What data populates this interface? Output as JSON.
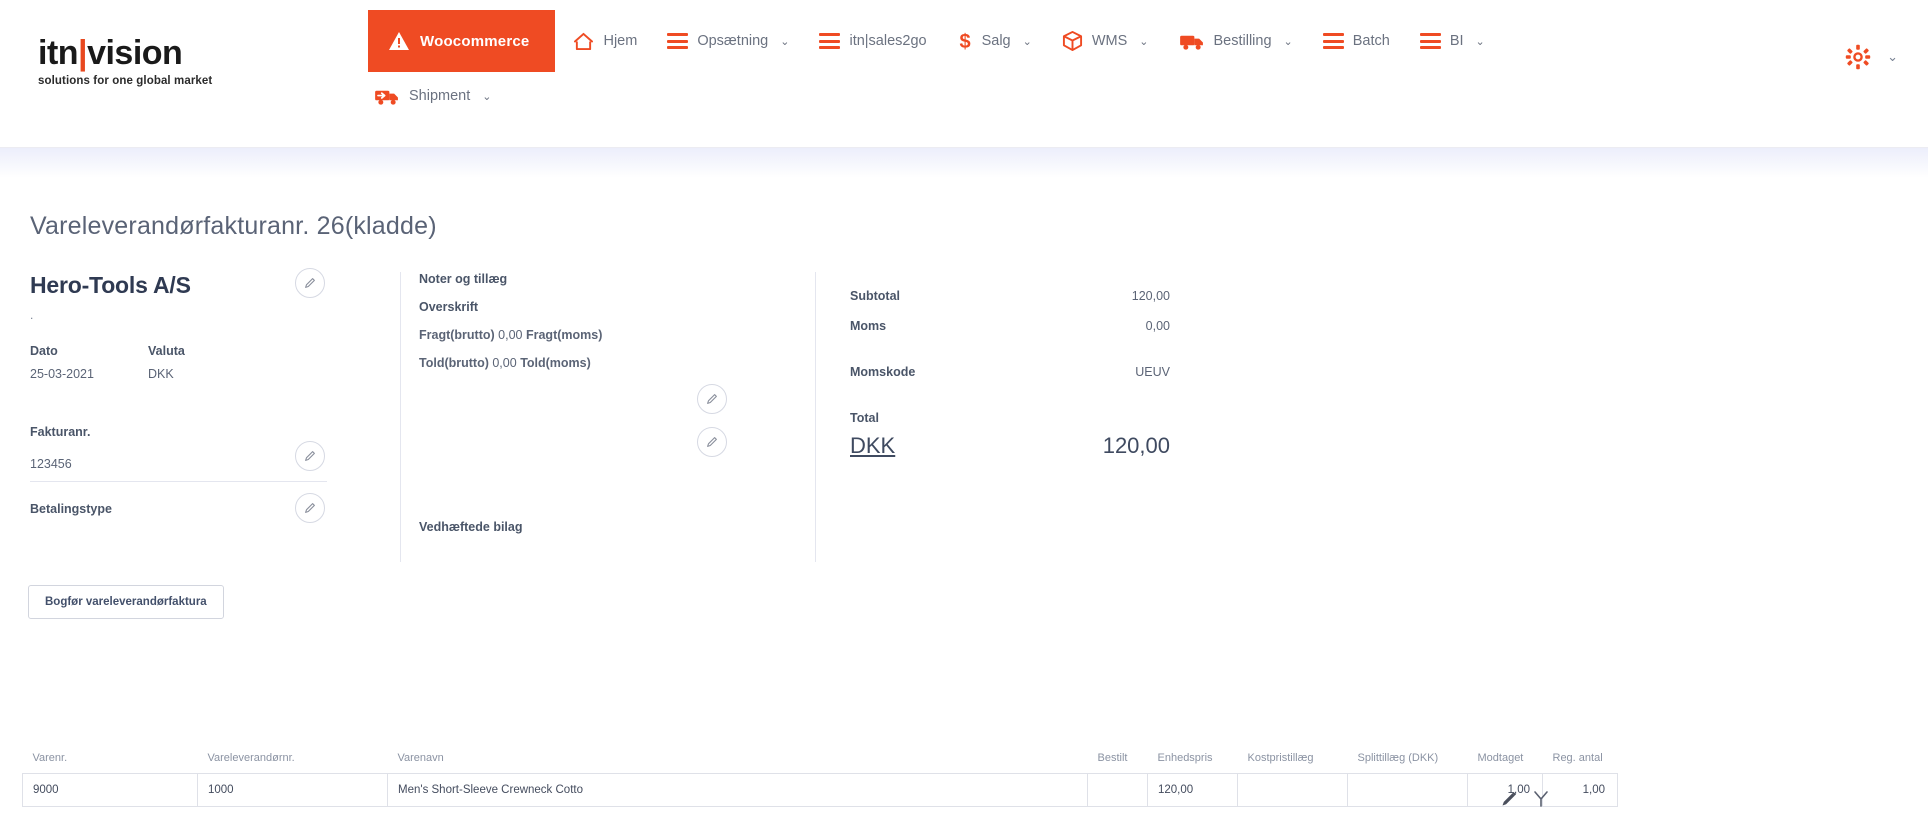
{
  "header": {
    "logo": {
      "text_a": "itn",
      "bar": "|",
      "text_b": "vision",
      "tagline": "solutions for one global market"
    },
    "brand_button": {
      "label": "Woocommerce",
      "icon": "warning-triangle-icon",
      "color": "#ef4b23"
    },
    "nav_row1": [
      {
        "label": "Hjem",
        "icon": "home-icon",
        "chevron": ""
      },
      {
        "label": "Opsætning",
        "icon": "hamburger-icon",
        "chevron": "⌄"
      },
      {
        "label": "itn|sales2go",
        "icon": "hamburger-icon",
        "chevron": ""
      },
      {
        "label": "Salg",
        "icon": "dollar-icon",
        "chevron": "⌄"
      },
      {
        "label": "WMS",
        "icon": "box-icon",
        "chevron": "⌄"
      },
      {
        "label": "Bestilling",
        "icon": "truck-icon",
        "chevron": "⌄"
      },
      {
        "label": "Batch",
        "icon": "hamburger-icon",
        "chevron": ""
      },
      {
        "label": "BI",
        "icon": "hamburger-icon",
        "chevron": "⌄"
      }
    ],
    "nav_row2": [
      {
        "label": "Shipment",
        "icon": "shipment-truck-icon",
        "chevron": "⌄"
      }
    ],
    "settings": {
      "icon": "gear-icon",
      "chevron": "⌄",
      "color": "#ef4b23"
    }
  },
  "page": {
    "title": "Vareleverandørfakturanr. 26(kladde)"
  },
  "vendor_card": {
    "name": "Hero-Tools A/S",
    "subtitle": ".",
    "date_label": "Dato",
    "date_value": "25-03-2021",
    "currency_label": "Valuta",
    "currency_value": "DKK",
    "invoice_no_label": "Fakturanr.",
    "invoice_no_value": "123456",
    "payment_type_label": "Betalingstype",
    "payment_type_value": ""
  },
  "notes_card": {
    "title": "Noter og tillæg",
    "heading": "Overskrift",
    "freight_gross_label": "Fragt(brutto)",
    "freight_gross_value": "0,00",
    "freight_vat_label": "Fragt(moms)",
    "customs_gross_label": "Told(brutto)",
    "customs_gross_value": "0,00",
    "customs_vat_label": "Told(moms)",
    "attachments_label": "Vedhæftede bilag"
  },
  "totals": {
    "subtotal_label": "Subtotal",
    "subtotal_value": "120,00",
    "vat_label": "Moms",
    "vat_value": "0,00",
    "vat_code_label": "Momskode",
    "vat_code_value": "UEUV",
    "total_label": "Total",
    "total_currency": "DKK",
    "total_value": "120,00"
  },
  "actions": {
    "post_invoice": "Bogfør vareleverandørfaktura"
  },
  "lines_table": {
    "columns": [
      "Varenr.",
      "Vareleverandørnr.",
      "Varenavn",
      "Bestilt",
      "Enhedspris",
      "Kostpristillæg",
      "Splittillæg (DKK)",
      "Modtaget",
      "Reg. antal"
    ],
    "rows": [
      {
        "item_no": "9000",
        "vendor_item_no": "1000",
        "item_name": "Men's Short-Sleeve Crewneck Cotto",
        "ordered": "",
        "unit_price": "120,00",
        "cost_surcharge": "",
        "split_surcharge": "",
        "received": "1,00",
        "reg_qty": "1,00"
      }
    ],
    "row_actions": [
      {
        "icon": "pencil-icon"
      },
      {
        "icon": "split-icon"
      }
    ]
  }
}
